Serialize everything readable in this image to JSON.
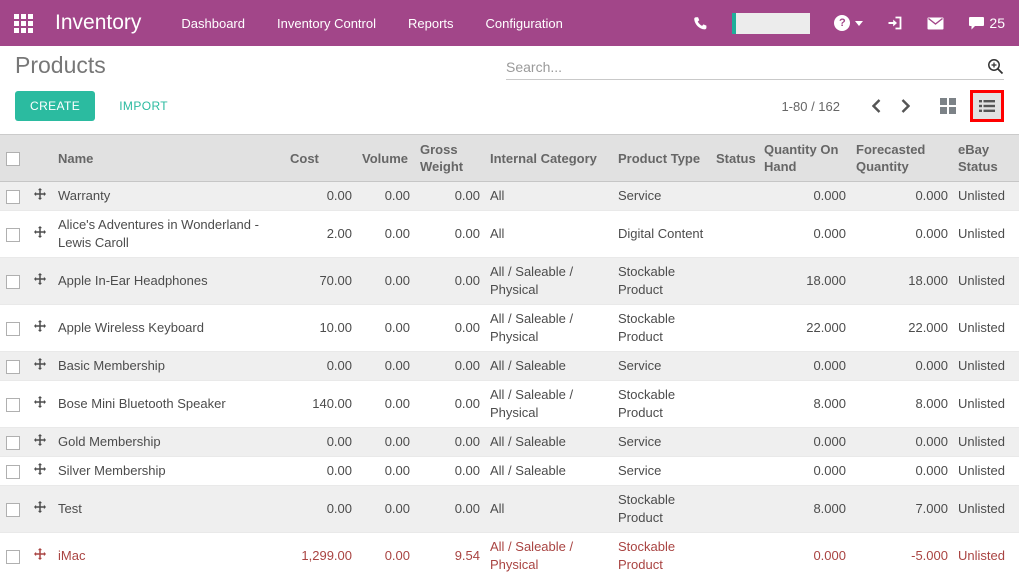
{
  "colors": {
    "navbar": "#a24689",
    "accent": "#2bbba0",
    "danger_text": "#a94442",
    "annotation": "#ff0000",
    "header_bg": "#e1e1e1",
    "stripe_bg": "#efefef"
  },
  "navbar": {
    "app_title": "Inventory",
    "menu_items": [
      "Dashboard",
      "Inventory Control",
      "Reports",
      "Configuration"
    ],
    "chat_count": "25",
    "help_label": "?"
  },
  "control_panel": {
    "title": "Products",
    "create_label": "CREATE",
    "import_label": "IMPORT",
    "search_placeholder": "Search...",
    "pager_range": "1-80 / 162"
  },
  "table": {
    "columns": [
      "Name",
      "Cost",
      "Volume",
      "Gross Weight",
      "Internal Category",
      "Product Type",
      "Status",
      "Quantity On Hand",
      "Forecasted Quantity",
      "eBay Status"
    ],
    "rows": [
      {
        "name": "Warranty",
        "cost": "0.00",
        "volume": "0.00",
        "gross_weight": "0.00",
        "internal_category": "All",
        "product_type": "Service",
        "status": "",
        "qty_on_hand": "0.000",
        "forecasted_qty": "0.000",
        "ebay_status": "Unlisted",
        "danger": false
      },
      {
        "name": "Alice's Adventures in Wonderland - Lewis Caroll",
        "cost": "2.00",
        "volume": "0.00",
        "gross_weight": "0.00",
        "internal_category": "All",
        "product_type": "Digital Content",
        "status": "",
        "qty_on_hand": "0.000",
        "forecasted_qty": "0.000",
        "ebay_status": "Unlisted",
        "danger": false
      },
      {
        "name": "Apple In-Ear Headphones",
        "cost": "70.00",
        "volume": "0.00",
        "gross_weight": "0.00",
        "internal_category": "All / Saleable / Physical",
        "product_type": "Stockable Product",
        "status": "",
        "qty_on_hand": "18.000",
        "forecasted_qty": "18.000",
        "ebay_status": "Unlisted",
        "danger": false
      },
      {
        "name": "Apple Wireless Keyboard",
        "cost": "10.00",
        "volume": "0.00",
        "gross_weight": "0.00",
        "internal_category": "All / Saleable / Physical",
        "product_type": "Stockable Product",
        "status": "",
        "qty_on_hand": "22.000",
        "forecasted_qty": "22.000",
        "ebay_status": "Unlisted",
        "danger": false
      },
      {
        "name": "Basic Membership",
        "cost": "0.00",
        "volume": "0.00",
        "gross_weight": "0.00",
        "internal_category": "All / Saleable",
        "product_type": "Service",
        "status": "",
        "qty_on_hand": "0.000",
        "forecasted_qty": "0.000",
        "ebay_status": "Unlisted",
        "danger": false
      },
      {
        "name": "Bose Mini Bluetooth Speaker",
        "cost": "140.00",
        "volume": "0.00",
        "gross_weight": "0.00",
        "internal_category": "All / Saleable / Physical",
        "product_type": "Stockable Product",
        "status": "",
        "qty_on_hand": "8.000",
        "forecasted_qty": "8.000",
        "ebay_status": "Unlisted",
        "danger": false
      },
      {
        "name": "Gold Membership",
        "cost": "0.00",
        "volume": "0.00",
        "gross_weight": "0.00",
        "internal_category": "All / Saleable",
        "product_type": "Service",
        "status": "",
        "qty_on_hand": "0.000",
        "forecasted_qty": "0.000",
        "ebay_status": "Unlisted",
        "danger": false
      },
      {
        "name": "Silver Membership",
        "cost": "0.00",
        "volume": "0.00",
        "gross_weight": "0.00",
        "internal_category": "All / Saleable",
        "product_type": "Service",
        "status": "",
        "qty_on_hand": "0.000",
        "forecasted_qty": "0.000",
        "ebay_status": "Unlisted",
        "danger": false
      },
      {
        "name": "Test",
        "cost": "0.00",
        "volume": "0.00",
        "gross_weight": "0.00",
        "internal_category": "All",
        "product_type": "Stockable Product",
        "status": "",
        "qty_on_hand": "8.000",
        "forecasted_qty": "7.000",
        "ebay_status": "Unlisted",
        "danger": false
      },
      {
        "name": "iMac",
        "cost": "1,299.00",
        "volume": "0.00",
        "gross_weight": "9.54",
        "internal_category": "All / Saleable / Physical",
        "product_type": "Stockable Product",
        "status": "",
        "qty_on_hand": "0.000",
        "forecasted_qty": "-5.000",
        "ebay_status": "Unlisted",
        "danger": true
      }
    ]
  }
}
